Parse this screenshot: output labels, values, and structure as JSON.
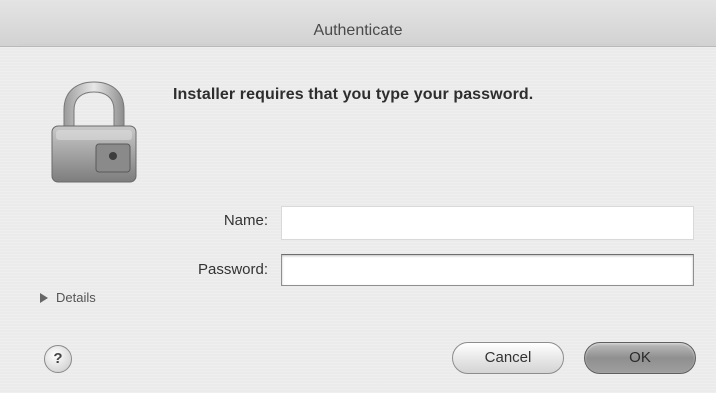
{
  "window": {
    "title": "Authenticate"
  },
  "dialog": {
    "message": "Installer requires that you type your password.",
    "icon": "lock-icon"
  },
  "form": {
    "name_label": "Name:",
    "name_value": "",
    "password_label": "Password:",
    "password_value": ""
  },
  "details": {
    "label": "Details",
    "icon": "disclosure-triangle-icon"
  },
  "buttons": {
    "help_label": "?",
    "cancel_label": "Cancel",
    "ok_label": "OK"
  },
  "colors": {
    "window_bg": "#ebebeb",
    "ok_button": "#9e9e9e",
    "text": "#2e2e2e"
  }
}
